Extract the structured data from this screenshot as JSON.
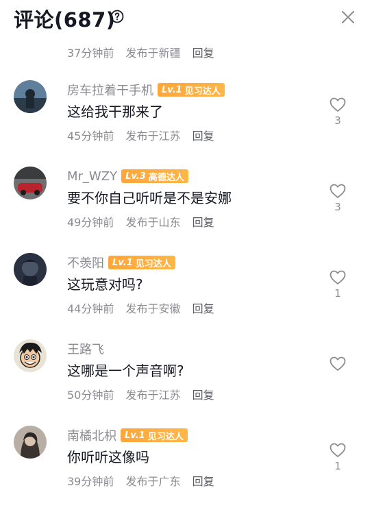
{
  "header": {
    "title": "评论(687)",
    "help_icon": "question-circle-icon",
    "close_icon": "close-icon"
  },
  "top_meta": {
    "time": "37分钟前",
    "location": "发布于新疆",
    "reply": "回复"
  },
  "comments": [
    {
      "username": "房车拉着干手机",
      "badge": {
        "level": "Lv.1",
        "title": "见习达人"
      },
      "text": "这给我干那来了",
      "time": "45分钟前",
      "location": "发布于江苏",
      "reply": "回复",
      "likes": "3"
    },
    {
      "username": "Mr_WZY",
      "badge": {
        "level": "Lv.3",
        "title": "高德达人"
      },
      "text": "要不你自己听听是不是安娜",
      "time": "49分钟前",
      "location": "发布于山东",
      "reply": "回复",
      "likes": "3"
    },
    {
      "username": "不羡阳",
      "badge": {
        "level": "Lv.1",
        "title": "见习达人"
      },
      "text": "这玩意对吗?",
      "time": "44分钟前",
      "location": "发布于安徽",
      "reply": "回复",
      "likes": "1"
    },
    {
      "username": "王路飞",
      "text": "这哪是一个声音啊?",
      "time": "50分钟前",
      "location": "发布于江苏",
      "reply": "回复"
    },
    {
      "username": "南橘北枳",
      "badge": {
        "level": "Lv.1",
        "title": "见习达人"
      },
      "text": "你听听这像吗",
      "time": "39分钟前",
      "location": "发布于广东",
      "reply": "回复",
      "likes": "1"
    }
  ],
  "colors": {
    "badge": "#ffa63a",
    "muted_text": "#8a8b91",
    "primary_text": "#161823"
  }
}
